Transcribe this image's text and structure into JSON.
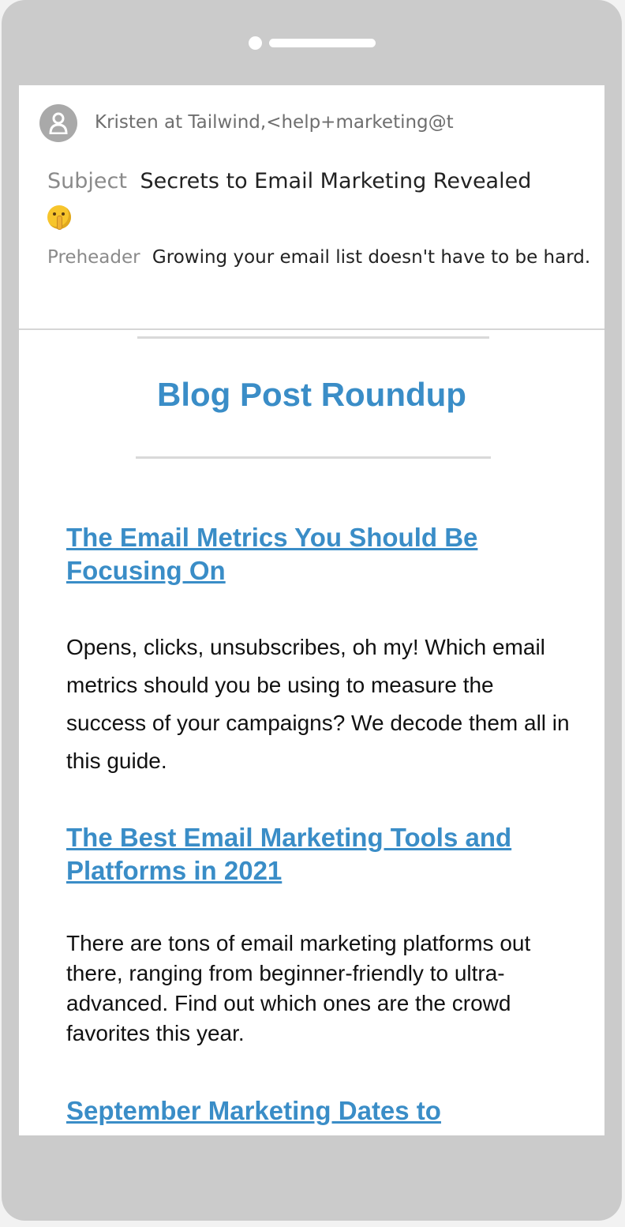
{
  "email": {
    "sender": "Kristen at Tailwind,<help+marketing@t",
    "subject_label": "Subject",
    "subject": "Secrets to Email Marketing Revealed",
    "subject_emoji": "shushing-face-emoji",
    "preheader_label": "Preheader",
    "preheader": "Growing your email list doesn't have to be hard."
  },
  "body": {
    "roundup_title": "Blog Post Roundup",
    "posts": [
      {
        "title": "The Email Metrics You Should Be Focusing On",
        "description": "Opens, clicks, unsubscribes, oh my! Which email metrics should you be using to measure the success of your campaigns? We decode them all in this guide."
      },
      {
        "title": "The Best Email Marketing Tools and Platforms in 2021",
        "description": "There are tons of email marketing platforms out there, ranging from beginner-friendly to ultra-advanced. Find out which ones are the crowd favorites this year."
      },
      {
        "title": "September Marketing Dates to"
      }
    ]
  },
  "colors": {
    "link": "#3a8dc7",
    "phone_frame": "#cbcbcb",
    "label_gray": "#8a8a8a"
  }
}
